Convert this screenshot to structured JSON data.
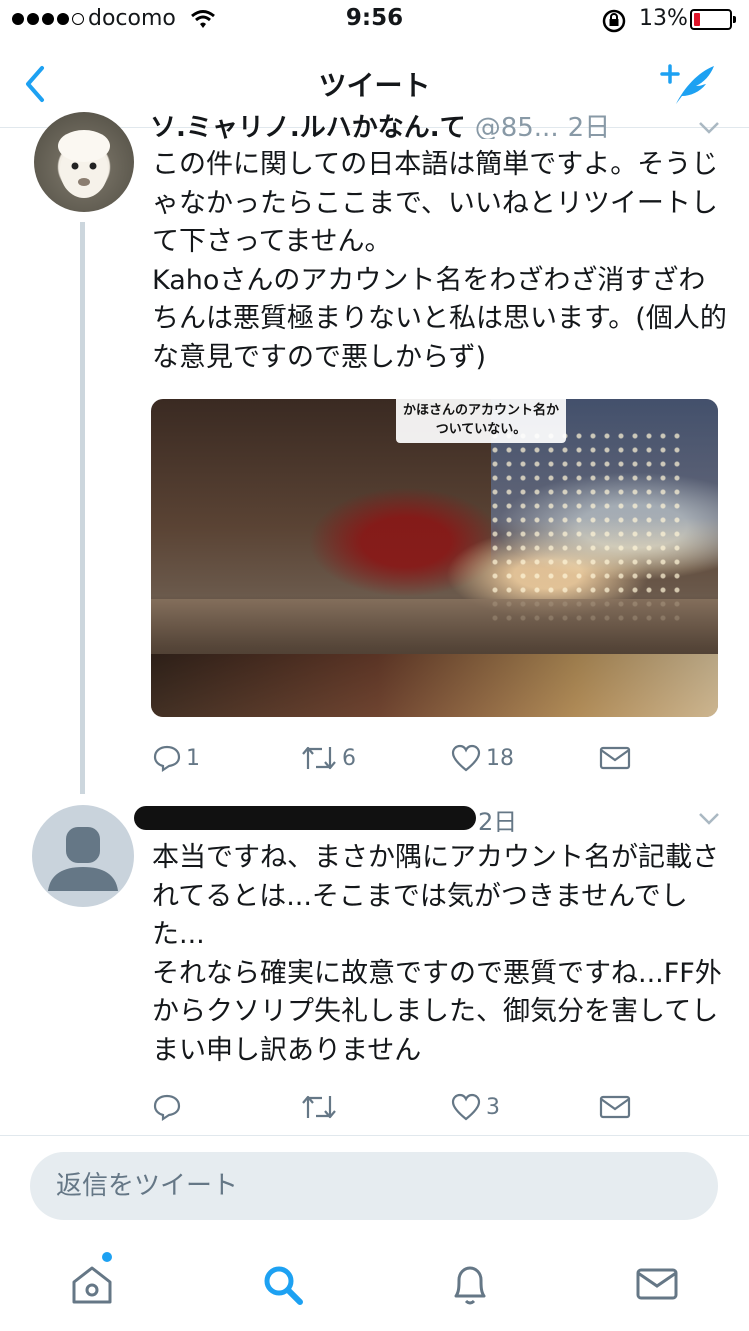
{
  "status_bar": {
    "carrier": "docomo",
    "time": "9:56",
    "battery_percent": "13%",
    "signal_strength": 4,
    "battery_level": 0.13
  },
  "nav": {
    "title": "ツイート",
    "back_icon": "chevron-left-icon",
    "compose_icon": "compose-tweet-icon",
    "accent_color": "#1da1f2"
  },
  "tweets": [
    {
      "name_visible": "ソ.ミャリノ.ルハかなん.て",
      "handle_visible": "@85...",
      "date": "2日",
      "text": "この件に関しての日本語は簡単ですよ。そうじゃなかったらここまで、いいねとリツイートして下さってません。\nKahoさんのアカウント名をわざわざ消すざわちんは悪質極まりないと私は思います。(個人的な意見ですので悪しからず)",
      "media_caption": "かほさんのアカウント名かついていない。",
      "reply_count": "1",
      "retweet_count": "6",
      "like_count": "18"
    },
    {
      "date": "2日",
      "text": "本当ですね、まさか隅にアカウント名が記載されてるとは...そこまでは気がつきませんでした...\nそれなら確実に故意ですので悪質ですね...FF外からクソリプ失礼しました、御気分を害してしまい申し訳ありません",
      "reply_count": "",
      "retweet_count": "",
      "like_count": "3"
    }
  ],
  "reply": {
    "placeholder": "返信をツイート"
  },
  "tabs": [
    {
      "icon": "home-icon"
    },
    {
      "icon": "search-icon"
    },
    {
      "icon": "bell-icon"
    },
    {
      "icon": "mail-icon"
    }
  ]
}
